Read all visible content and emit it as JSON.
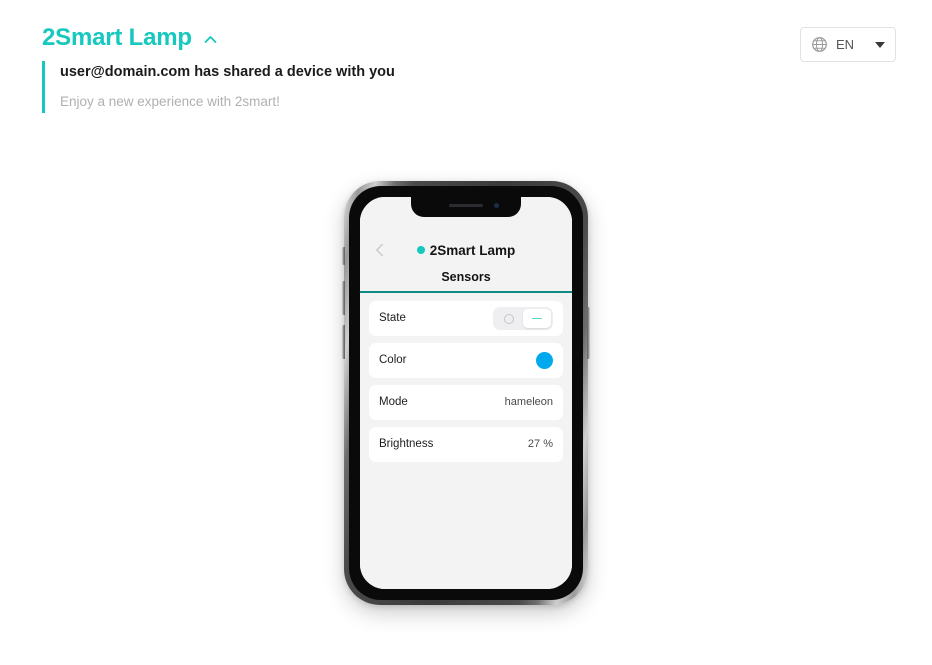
{
  "header": {
    "brand_title": "2Smart Lamp",
    "brand_caret_icon": "chevron-up-icon",
    "notice_title": "user@domain.com has shared a device with you",
    "notice_subtitle": "Enjoy a new experience with 2smart!",
    "accent_color": "#16c8bd"
  },
  "language_select": {
    "globe_icon": "globe-icon",
    "code": "EN",
    "caret_icon": "chevron-down-icon"
  },
  "phone": {
    "app": {
      "navbar": {
        "back_icon": "chevron-left-icon",
        "status_dot": "online-status-dot",
        "title": "2Smart Lamp"
      },
      "tabs": [
        {
          "label": "Sensors",
          "active": true
        }
      ],
      "rows": [
        {
          "label": "State",
          "control": "segmented",
          "segments": [
            {
              "icon": "circle-icon",
              "active": false
            },
            {
              "icon": "dash-icon",
              "active": true
            }
          ]
        },
        {
          "label": "Color",
          "control": "color-swatch",
          "color": "#00a8ee"
        },
        {
          "label": "Mode",
          "control": "text",
          "value": "hameleon"
        },
        {
          "label": "Brightness",
          "control": "text",
          "value": "27 %"
        }
      ]
    }
  }
}
